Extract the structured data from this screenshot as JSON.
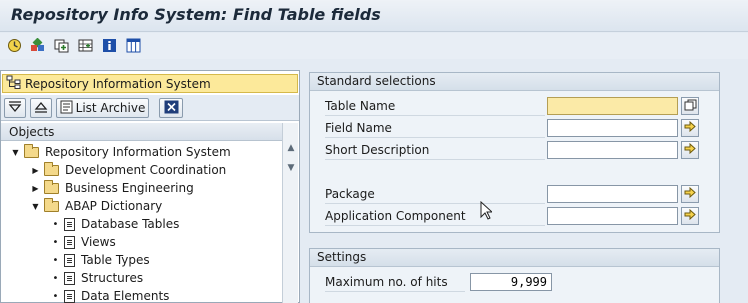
{
  "window": {
    "title": "Repository Info System: Find Table fields"
  },
  "toolbar": {
    "icons": [
      "execute-icon",
      "other-object-icon",
      "all-selections-icon",
      "insert-line-icon",
      "info-icon",
      "columns-icon"
    ]
  },
  "navigator": {
    "title": "Repository Information System",
    "list_archive_label": "List Archive",
    "objects_header": "Objects",
    "tree": [
      {
        "label": "Repository Information System",
        "level": 0,
        "type": "folder",
        "expanded": true
      },
      {
        "label": "Development Coordination",
        "level": 1,
        "type": "folder",
        "expanded": false
      },
      {
        "label": "Business Engineering",
        "level": 1,
        "type": "folder",
        "expanded": false
      },
      {
        "label": "ABAP Dictionary",
        "level": 1,
        "type": "folder",
        "expanded": true
      },
      {
        "label": "Database Tables",
        "level": 2,
        "type": "doc"
      },
      {
        "label": "Views",
        "level": 2,
        "type": "doc"
      },
      {
        "label": "Table Types",
        "level": 2,
        "type": "doc"
      },
      {
        "label": "Structures",
        "level": 2,
        "type": "doc"
      },
      {
        "label": "Data Elements",
        "level": 2,
        "type": "doc"
      }
    ]
  },
  "standard_selections": {
    "title": "Standard selections",
    "fields": [
      {
        "label": "Table Name",
        "value": "",
        "required": true
      },
      {
        "label": "Field Name",
        "value": ""
      },
      {
        "label": "Short Description",
        "value": ""
      },
      {
        "label": "Package",
        "value": ""
      },
      {
        "label": "Application Component",
        "value": ""
      }
    ]
  },
  "settings": {
    "title": "Settings",
    "max_hits_label": "Maximum no. of hits",
    "max_hits_value": "9,999"
  },
  "colors": {
    "required_field": "#fbeaa7",
    "nav_header": "#fce99a",
    "background": "#e4ebf3"
  }
}
